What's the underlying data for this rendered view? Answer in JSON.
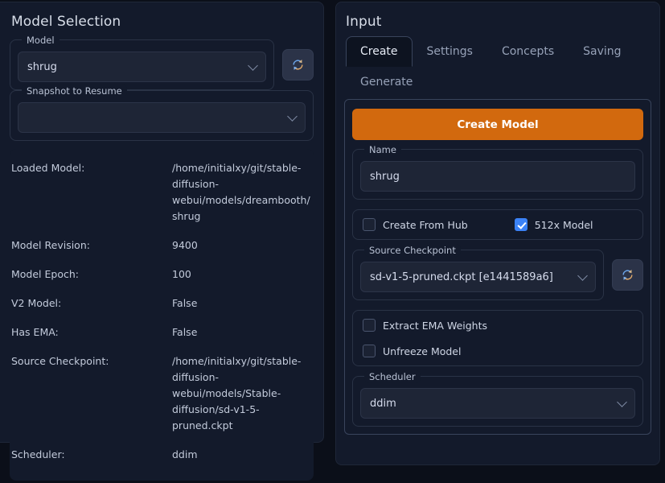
{
  "left_panel": {
    "title": "Model Selection",
    "model_group": {
      "label": "Model",
      "value": "shrug"
    },
    "refresh_models_icon": "refresh-icon",
    "snapshot_group": {
      "label": "Snapshot to Resume",
      "value": ""
    },
    "info": [
      {
        "key": "Loaded Model:",
        "value": "/home/initialxy/git/stable-diffusion-webui/models/dreambooth/shrug"
      },
      {
        "key": "Model Revision:",
        "value": "9400"
      },
      {
        "key": "Model Epoch:",
        "value": "100"
      },
      {
        "key": "V2 Model:",
        "value": "False"
      },
      {
        "key": "Has EMA:",
        "value": "False"
      },
      {
        "key": "Source Checkpoint:",
        "value": "/home/initialxy/git/stable-diffusion-webui/models/Stable-diffusion/sd-v1-5-pruned.ckpt"
      },
      {
        "key": "Scheduler:",
        "value": "ddim"
      }
    ]
  },
  "right_panel": {
    "title": "Input",
    "tabs": [
      {
        "label": "Create",
        "active": true
      },
      {
        "label": "Settings",
        "active": false
      },
      {
        "label": "Concepts",
        "active": false
      },
      {
        "label": "Saving",
        "active": false
      },
      {
        "label": "Generate",
        "active": false
      }
    ],
    "create_model_button": "Create Model",
    "name_group": {
      "label": "Name",
      "value": "shrug"
    },
    "checkboxes_top": [
      {
        "label": "Create From Hub",
        "checked": false
      },
      {
        "label": "512x Model",
        "checked": true
      }
    ],
    "source_checkpoint_group": {
      "label": "Source Checkpoint",
      "value": "sd-v1-5-pruned.ckpt [e1441589a6]"
    },
    "refresh_checkpoints_icon": "refresh-icon",
    "checkboxes_bottom": [
      {
        "label": "Extract EMA Weights",
        "checked": false
      },
      {
        "label": "Unfreeze Model",
        "checked": false
      }
    ],
    "scheduler_group": {
      "label": "Scheduler",
      "value": "ddim"
    }
  },
  "colors": {
    "page_background": "#0b0f19",
    "panel_background": "#131a2b",
    "accent_orange": "#d2690e",
    "accent_blue": "#3b82f6",
    "text_primary": "#d8dee9"
  }
}
